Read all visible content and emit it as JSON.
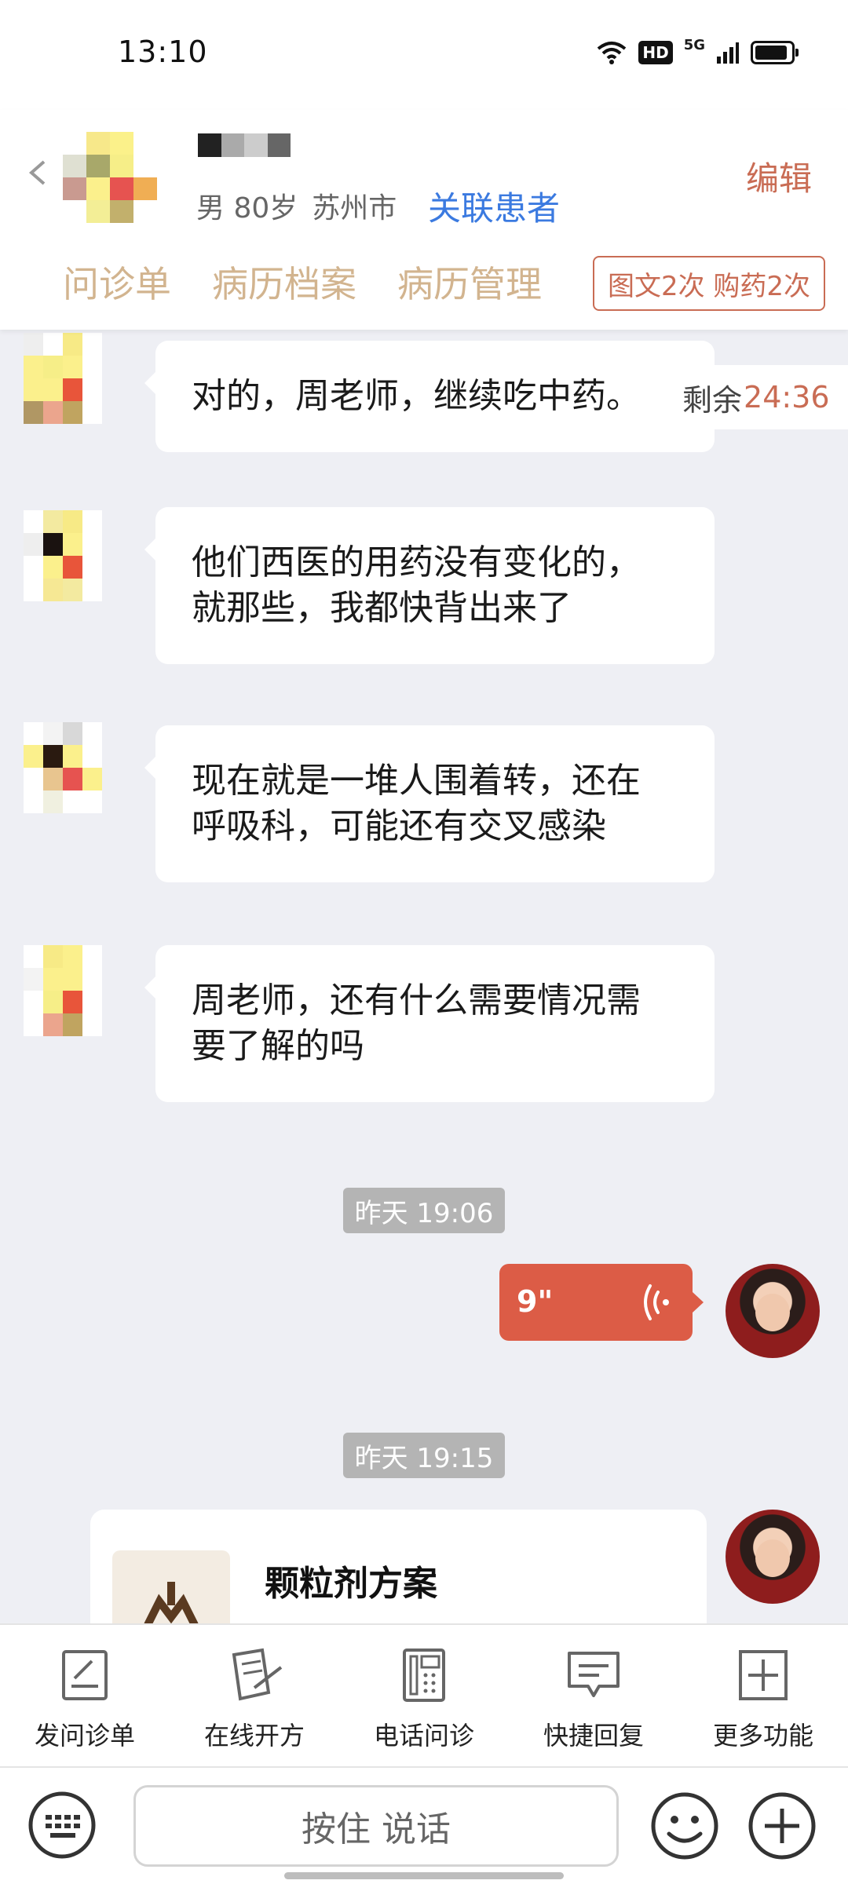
{
  "status_bar": {
    "time": "13:10",
    "hd_label": "HD",
    "network_label": "5G"
  },
  "patient": {
    "gender_age": "男 80岁",
    "city": "苏州市",
    "link_label": "关联患者",
    "edit_label": "编辑"
  },
  "tabs": [
    {
      "label": "问诊单"
    },
    {
      "label": "病历档案"
    },
    {
      "label": "病历管理"
    }
  ],
  "quota_label": "图文2次 购药2次",
  "countdown": {
    "prefix": "剩余",
    "value": "24:36"
  },
  "messages": [
    {
      "lines": [
        "对的，周老师，继续吃中药。"
      ]
    },
    {
      "lines": [
        "他们西医的用药没有变化的，",
        "就那些，我都快背出来了"
      ]
    },
    {
      "lines": [
        "现在就是一堆人围着转，还在",
        "呼吸科，可能还有交叉感染"
      ]
    },
    {
      "lines": [
        "周老师，还有什么需要情况需",
        "要了解的吗"
      ]
    }
  ],
  "timestamps": [
    "昨天 19:06",
    "昨天 19:15"
  ],
  "voice_message": {
    "duration": "9\""
  },
  "prescription_card": {
    "title": "颗粒剂方案"
  },
  "function_bar": [
    {
      "label": "发问诊单",
      "icon": "form-icon"
    },
    {
      "label": "在线开方",
      "icon": "prescription-icon"
    },
    {
      "label": "电话问诊",
      "icon": "phone-icon"
    },
    {
      "label": "快捷回复",
      "icon": "quick-reply-icon"
    },
    {
      "label": "更多功能",
      "icon": "plus-square-icon"
    }
  ],
  "input_bar": {
    "voice_button_label": "按住 说话"
  },
  "colors": {
    "accent": "#dc5c46",
    "tab_text": "#d2b48f",
    "link": "#3b7ae0",
    "chat_bg": "#eeeff4"
  }
}
